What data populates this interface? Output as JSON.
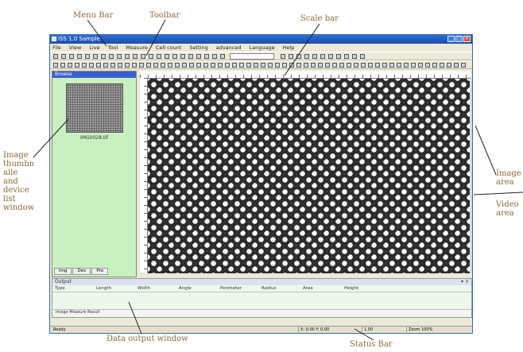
{
  "annotations": {
    "menu_bar": "Menu Bar",
    "toolbar": "Toolbar",
    "scale_bar": "Scale bar",
    "image_thumbnail": "Image\nthumbn\naile\nand\ndevice\nlist\nwindow",
    "image_area": "Image\narea",
    "video_area": "Video\narea",
    "data_output": "Data output window",
    "status_bar": "Status Bar"
  },
  "window": {
    "title": "ISS 1.0 Sample",
    "menus": [
      "File",
      "View",
      "Live",
      "Tool",
      "Measure",
      "Cell count",
      "Setting",
      "advanced",
      "Language",
      "Help"
    ]
  },
  "left_panel": {
    "title": "Browse",
    "thumbnail_name": "IMG0028.tif",
    "tabs": [
      "Img",
      "Dev",
      "Pro"
    ]
  },
  "data_output": {
    "title": "Output",
    "columns": [
      "Type",
      "Length",
      "Width",
      "Angle",
      "Perimeter",
      "Radius",
      "Area",
      "Height"
    ],
    "row": "Image Measure Result"
  },
  "status_bar": {
    "left": "Ready",
    "coords": "X: 0.00  Y: 0.00",
    "size": "1.00",
    "zoom": "Zoom 100%"
  },
  "colors": {
    "titlebar": "#1b4fb0",
    "left_panel_bg": "#c8f0c0",
    "annotation": "#8a6a3a"
  }
}
